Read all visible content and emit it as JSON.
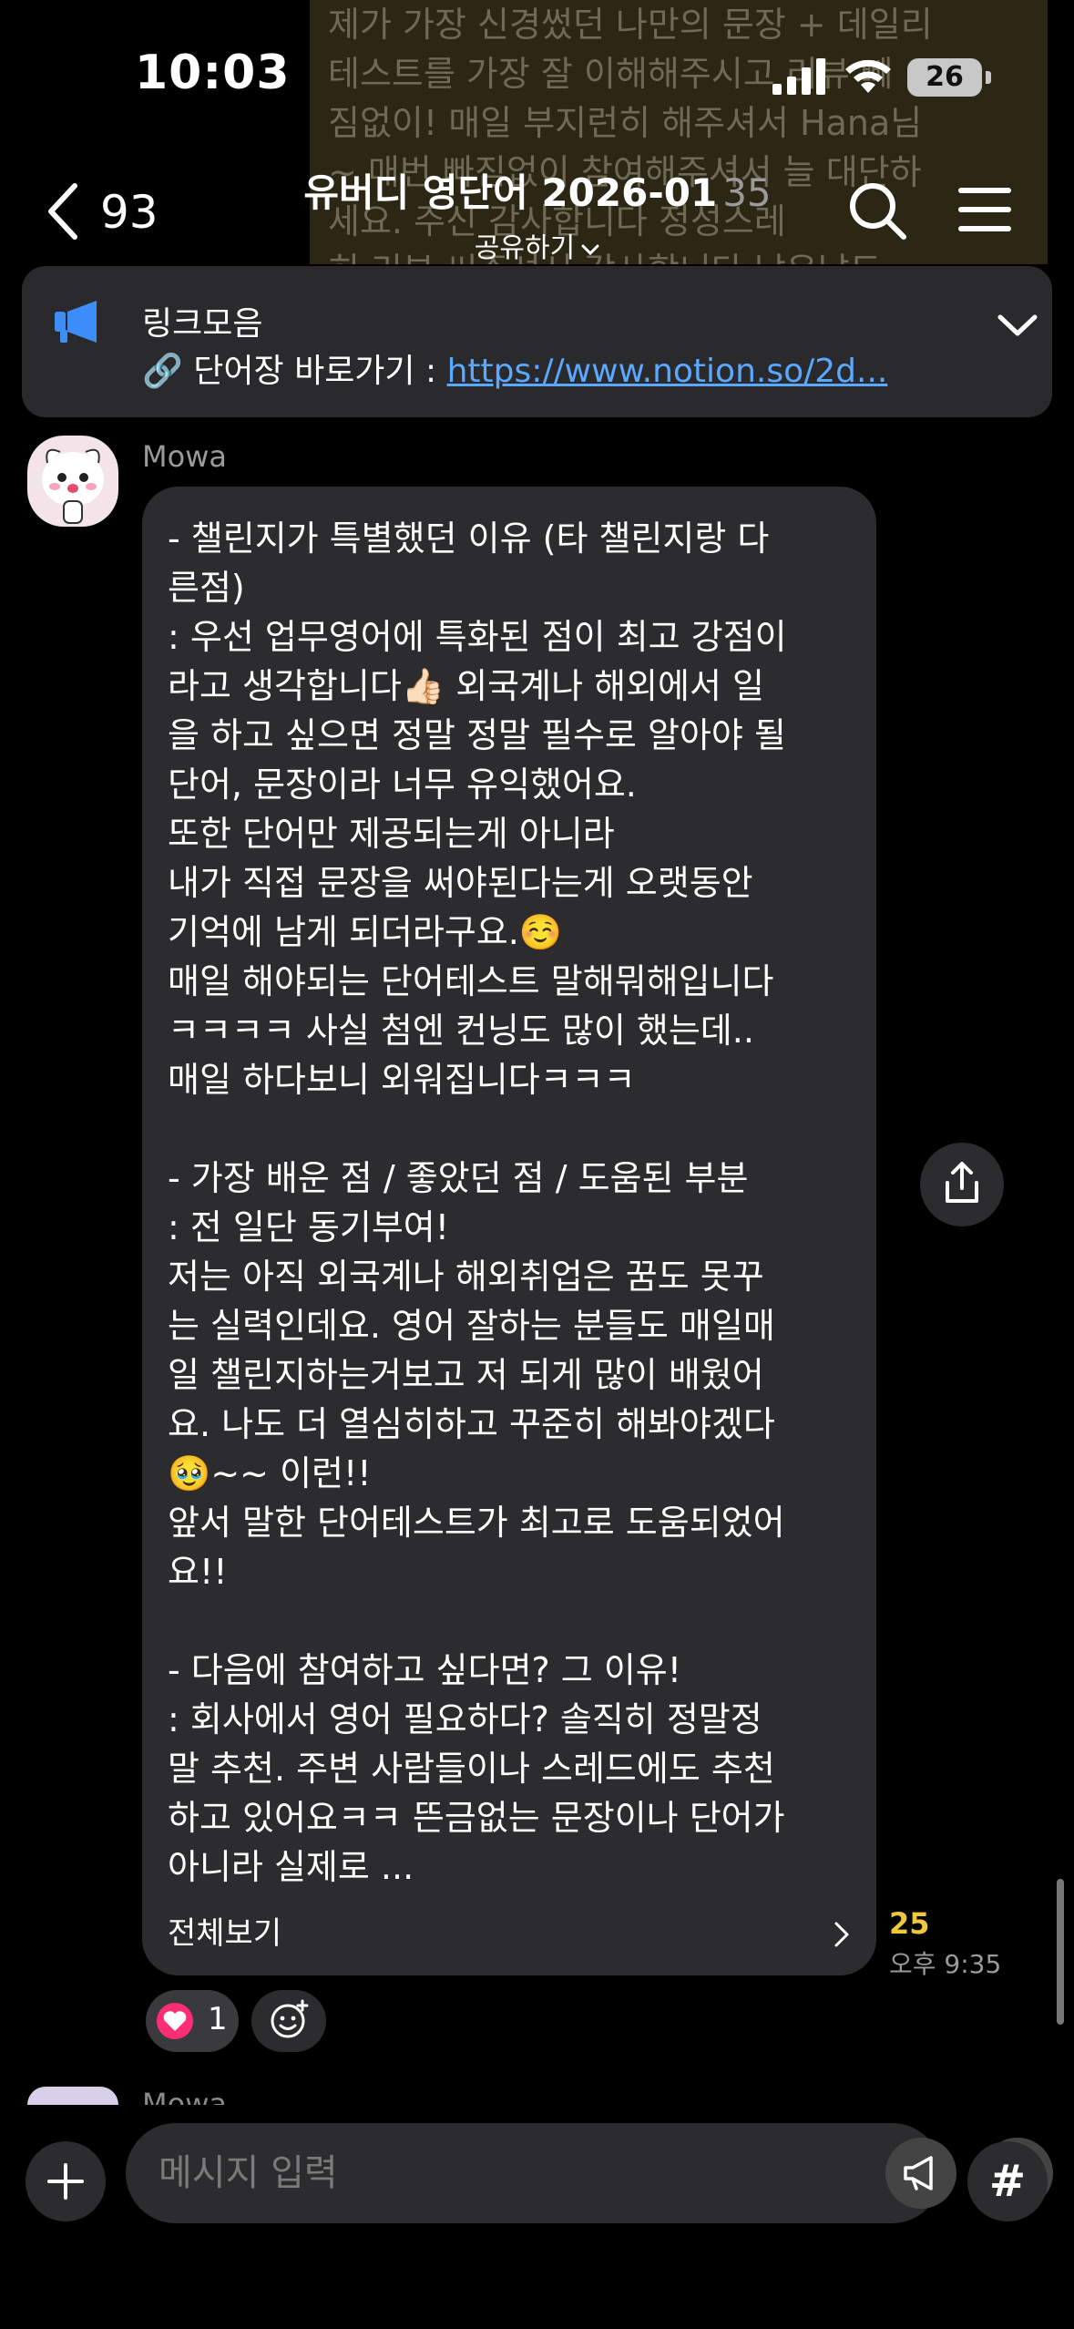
{
  "status_bar": {
    "time": "10:03",
    "battery_level": "26"
  },
  "background_message": {
    "lines": [
      "제가 가장 신경썼던 나만의 문장 + 데일리",
      "테스트를 가장 잘 이해해주시고 리뷰 빼",
      "짐없이! 매일 부지런히 해주셔서 Hana님",
      "~ 매번 빠짐없이 참여해주셔서 늘 대단하",
      "세요. 주신 감사합니다 정성스레",
      "히 리뷰 써주셔서 감사합니다 남은날도"
    ]
  },
  "nav": {
    "back_count": "93",
    "title": "유버디 영단어 2026-01",
    "member_count": "35",
    "share_label": "공유하기"
  },
  "notice": {
    "title": "링크모음",
    "body_prefix": "🔗 단어장 바로가기 : ",
    "link_text": "https://www.notion.so/2d..."
  },
  "message": {
    "sender": "Mowa",
    "body": "- 챌린지가 특별했던 이유 (타 챌린지랑 다\n른점)\n: 우선 업무영어에 특화된 점이 최고 강점이\n라고 생각합니다👍🏻 외국계나 해외에서 일\n을 하고 싶으면 정말 정말 필수로 알아야 될\n단어, 문장이라 너무 유익했어요.\n또한 단어만 제공되는게 아니라\n내가 직접 문장을 써야된다는게 오랫동안\n기억에 남게 되더라구요.☺️\n매일 해야되는 단어테스트 말해뭐해입니다\nㅋㅋㅋㅋ 사실 첨엔 컨닝도 많이 했는데..\n매일 하다보니 외워집니다ㅋㅋㅋ\n\n- 가장 배운 점 / 좋았던 점 / 도움된 부분\n: 전 일단 동기부여!\n저는 아직 외국계나 해외취업은 꿈도 못꾸\n는 실력인데요. 영어 잘하는 분들도 매일매\n일 챌린지하는거보고 저 되게 많이 배웠어\n요. 나도 더 열심히하고 꾸준히 해봐야겠다\n🥹~~ 이런!!\n앞서 말한 단어테스트가 최고로 도움되었어\n요!!\n\n- 다음에 참여하고 싶다면? 그 이유!\n: 회사에서 영어 필요하다? 솔직히 정말정\n말 추천. 주변 사람들이나 스레드에도 추천\n하고 있어요ㅋㅋ 뜬금없는 문장이나 단어가\n아니라 실제로 ...",
    "view_all_label": "전체보기",
    "unread_count": "25",
    "time": "오후 9:35",
    "reaction_count": "1"
  },
  "next_message": {
    "sender": "Mowa"
  },
  "input": {
    "placeholder": "메시지 입력",
    "hash_label": "#"
  }
}
